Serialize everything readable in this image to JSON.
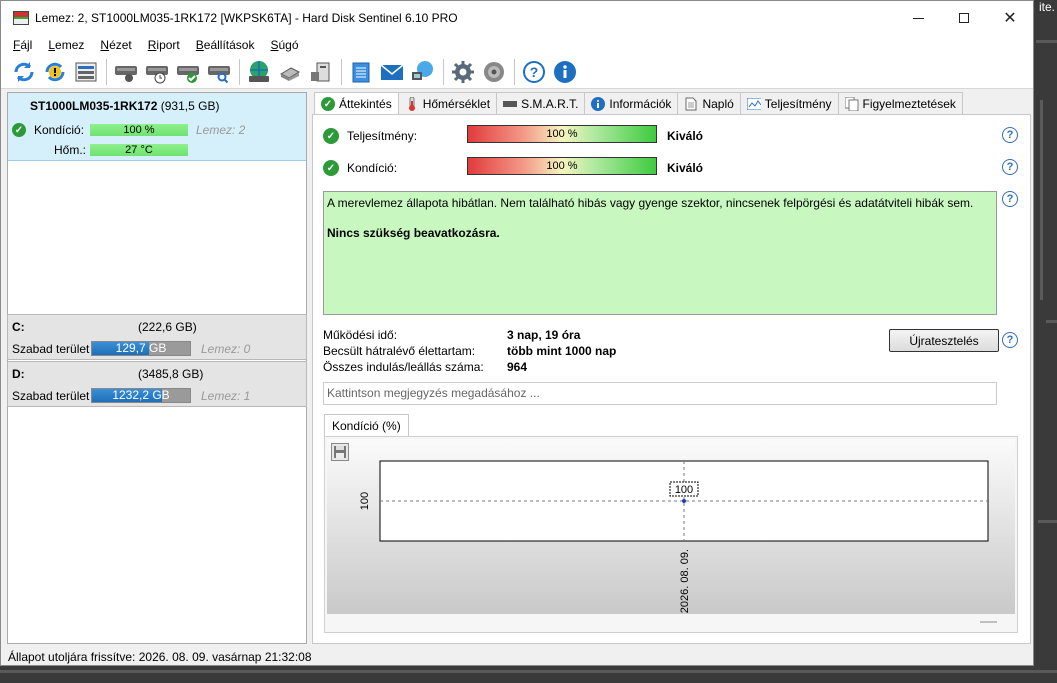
{
  "window": {
    "title": "Lemez: 2, ST1000LM035-1RK172 [WKPSK6TA]  -  Hard Disk Sentinel 6.10 PRO",
    "controls": [
      "minimize",
      "maximize",
      "close"
    ]
  },
  "background_corner_text": "ite.",
  "menu": [
    "Fájl",
    "Lemez",
    "Nézet",
    "Riport",
    "Beállítások",
    "Súgó"
  ],
  "toolbar_icons": [
    "refresh-icon",
    "refresh-warning-icon",
    "disk-list-icon",
    "disk-settings-icon",
    "disk-clock-icon",
    "disk-ok-icon",
    "disk-search-icon",
    "globe-disk-icon",
    "usb-disk-icon",
    "external-disk-icon",
    "notepad-icon",
    "mail-icon",
    "network-icon",
    "gear-icon",
    "speaker-icon",
    "help-icon",
    "info-icon"
  ],
  "disk": {
    "name": "ST1000LM035-1RK172",
    "size": "(931,5 GB)",
    "condition_label": "Kondíció:",
    "condition_value": "100 %",
    "disk_label": "Lemez: 2",
    "temp_label": "Hőm.:",
    "temp_value": "27 °C"
  },
  "volumes": [
    {
      "name": "C:",
      "size": "(222,6 GB)",
      "free_label": "Szabad terület",
      "free_value": "129,7 GB",
      "free_fraction": 0.58,
      "disk_label": "Lemez: 0"
    },
    {
      "name": "D:",
      "size": "(3485,8 GB)",
      "free_label": "Szabad terület",
      "free_value": "1232,2 GB",
      "free_fraction": 0.71,
      "disk_label": "Lemez: 1"
    }
  ],
  "status_bar": "Állapot utoljára frissítve: 2026. 08. 09. vasárnap 21:32:08",
  "tabs": [
    "Áttekintés",
    "Hőmérséklet",
    "S.M.A.R.T.",
    "Információk",
    "Napló",
    "Teljesítmény",
    "Figyelmeztetések"
  ],
  "overview": {
    "performance_label": "Teljesítmény:",
    "performance_value": "100 %",
    "performance_rating": "Kiváló",
    "condition_label": "Kondíció:",
    "condition_value": "100 %",
    "condition_rating": "Kiváló",
    "description": "A merevlemez állapota hibátlan. Nem található hibás vagy gyenge szektor, nincsenek felpörgési és adatátviteli hibák sem.",
    "recommendation": "Nincs szükség beavatkozásra.",
    "uptime_label": "Működési idő:",
    "uptime_value": "3 nap, 19 óra",
    "lifetime_label": "Becsült hátralévő élettartam:",
    "lifetime_value": "több mint 1000 nap",
    "starts_label": "Összes indulás/leállás száma:",
    "starts_value": "964",
    "retest_button": "Újratesztelés",
    "note_placeholder": "Kattintson megjegyzés megadásához ...",
    "chart_tab": "Kondíció  (%)"
  },
  "chart_data": {
    "type": "line",
    "title": "",
    "xlabel": "",
    "ylabel": "",
    "x": [
      "2026. 08. 09."
    ],
    "series": [
      {
        "values": [
          100
        ]
      }
    ],
    "ylim": [
      99,
      101
    ],
    "y_ticks": [
      "100"
    ],
    "data_labels": [
      "100"
    ],
    "grid": true
  }
}
